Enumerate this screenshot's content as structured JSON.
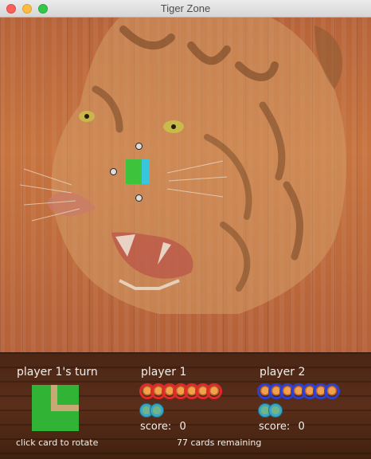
{
  "window": {
    "title": "Tiger Zone"
  },
  "board": {
    "placed_tile": {
      "left_terrain": "grass",
      "right_terrain": "water"
    }
  },
  "panel": {
    "turn_text": "player 1's turn",
    "current_tile": {
      "terrain": "grass",
      "feature": "trail-corner"
    },
    "hint_text": "click card to rotate",
    "cards_remaining_text": "77 cards remaining"
  },
  "players": [
    {
      "name": "player 1",
      "score_label": "score:",
      "score": 0,
      "tigers_remaining": 7,
      "crocodiles_remaining": 2,
      "color": "#e02a2a"
    },
    {
      "name": "player 2",
      "score_label": "score:",
      "score": 0,
      "tigers_remaining": 7,
      "crocodiles_remaining": 2,
      "color": "#2f40d0"
    }
  ],
  "colors": {
    "grass": "#3ec43c",
    "water": "#38c6dc",
    "trail": "#c8a874"
  }
}
